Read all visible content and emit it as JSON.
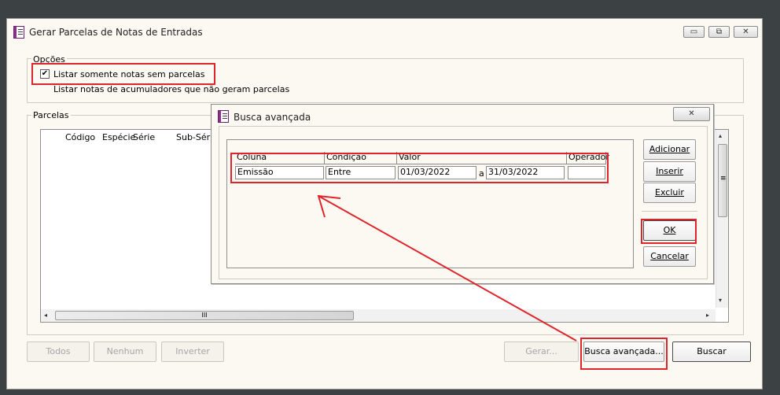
{
  "window": {
    "title": "Gerar Parcelas de Notas de Entradas",
    "minimize": "▭",
    "restore": "⧉",
    "close": "✕"
  },
  "opcoes": {
    "legend": "Opções",
    "option1": "Listar somente notas sem parcelas",
    "option1_checked": "✔",
    "option2": "Listar notas de acumuladores que não geram parcelas"
  },
  "parcelas": {
    "legend": "Parcelas",
    "columns": [
      "Código",
      "Espécie",
      "Série",
      "Sub-Série"
    ],
    "h_thumb_grip": "III",
    "v_thumb_grip": "≡",
    "arrow_left": "◂",
    "arrow_right": "▸",
    "arrow_up": "▴",
    "arrow_down": "▾"
  },
  "buttons": {
    "todos": "Todos",
    "nenhum": "Nenhum",
    "inverter": "Inverter",
    "gerar": "Gerar...",
    "busca_avancada": "Busca avançada...",
    "buscar": "Buscar"
  },
  "dialog": {
    "title": "Busca avançada",
    "close": "✕",
    "headers": {
      "coluna": "Coluna",
      "condicao": "Condição",
      "valor": "Valor",
      "operador": "Operador"
    },
    "row": {
      "coluna": "Emissão",
      "condicao": "Entre",
      "valor_de": "01/03/2022",
      "separator": "a",
      "valor_ate": "31/03/2022",
      "operador": ""
    },
    "buttons": {
      "adicionar": "Adicionar",
      "inserir": "Inserir",
      "excluir": "Excluir",
      "ok": "OK",
      "cancelar": "Cancelar"
    }
  },
  "colors": {
    "annotation_red": "#e0242c",
    "desktop": "#3c4243",
    "window_bg": "#fbf9f1"
  }
}
